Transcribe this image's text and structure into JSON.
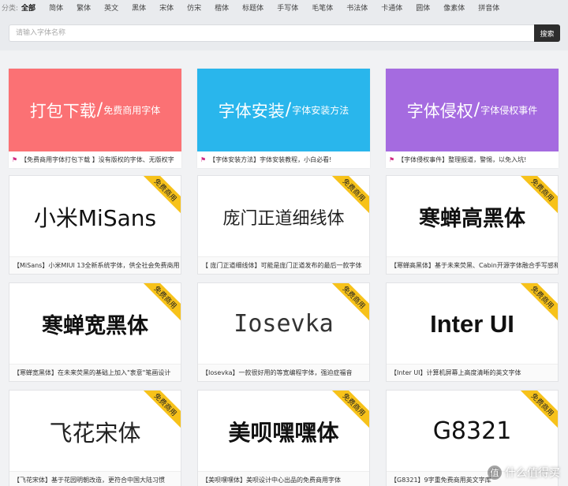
{
  "categories": {
    "label": "分类:",
    "items": [
      "全部",
      "简体",
      "繁体",
      "英文",
      "黑体",
      "宋体",
      "仿宋",
      "楷体",
      "标题体",
      "手写体",
      "毛笔体",
      "书法体",
      "卡通体",
      "圆体",
      "像素体",
      "拼音体"
    ],
    "active_index": 0
  },
  "search": {
    "placeholder": "请输入字体名称",
    "value": "",
    "button_label": "搜索"
  },
  "banners": [
    {
      "big": "打包下载",
      "slash": "/",
      "small": "免费商用字体",
      "color": "#fb7174",
      "caption": "【免费商用字体打包下载 】没有版权的字体、无版权字"
    },
    {
      "big": "字体安装",
      "slash": "/",
      "small": "字体安装方法",
      "color": "#29b6ec",
      "caption": "【字体安装方法】字体安装教程，小白必看!"
    },
    {
      "big": "字体侵权",
      "slash": "/",
      "small": "字体侵权事件",
      "color": "#a56be0",
      "caption": "【字体侵权事件】整理报道，警惕，以免入坑!"
    }
  ],
  "ribbon_label": "免费商用",
  "cards": [
    {
      "preview": "小米MiSans",
      "caption": "【MiSans】小米MIUI 13全新系统字体，供全社会免费商用"
    },
    {
      "preview": "庞门正道细线体",
      "caption": "【 庞门正道细线体】可能是庞门正道发布的最后一款字体"
    },
    {
      "preview": "寒蝉高黑体",
      "caption": "【寒蝉高黑体】基于未来荧黑、Cabin开源字体融合手写感和"
    },
    {
      "preview": "寒蝉宽黑体",
      "caption": "【寒蝉宽黑体】在未来荧黑的基础上加入\"衷意\"笔画设计"
    },
    {
      "preview": "Iosevka",
      "caption": "【Iosevka】一款很好用的等宽编程字体，强迫症福音"
    },
    {
      "preview": "Inter UI",
      "caption": "【Inter UI】计算机屏幕上高度清晰的英文字体"
    },
    {
      "preview": "飞花宋体",
      "caption": "【飞花宋体】基于花园明朝改造，更符合中国大陆习惯"
    },
    {
      "preview": "美呗嘿嘿体",
      "caption": "【美呗嘿嘿体】美呗设计中心出品的免费商用字体"
    },
    {
      "preview": "G8321",
      "caption": "【G8321】9字重免费商用英文字库"
    }
  ],
  "watermark": {
    "badge": "值",
    "text": "什么值得买"
  }
}
